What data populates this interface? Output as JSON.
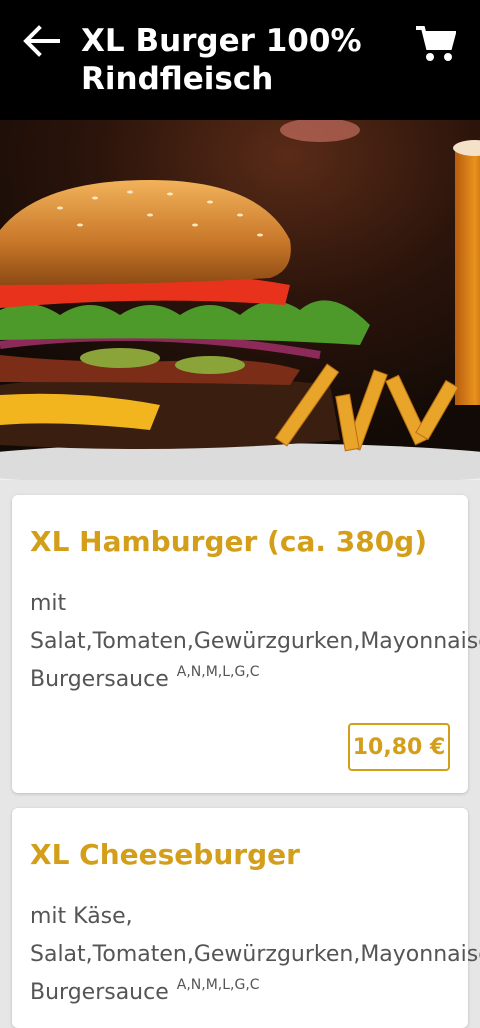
{
  "header": {
    "title": "XL Burger 100% Rindfleisch",
    "back_icon": "arrow-left-icon",
    "cart_icon": "shopping-cart-icon"
  },
  "products": [
    {
      "name": "XL Hamburger (ca. 380g)",
      "desc_line1": "mit",
      "desc_line2": "Salat,Tomaten,Gewürzgurken,Mayonnaise,",
      "desc_line3": "Burgersauce",
      "allergens": "A,N,M,L,G,C",
      "price": "10,80 €"
    },
    {
      "name": "XL Cheeseburger",
      "desc_line1": "mit Käse,",
      "desc_line2": "Salat,Tomaten,Gewürzgurken,Mayonnaise,",
      "desc_line3": "Burgersauce",
      "allergens": "A,N,M,L,G,C"
    }
  ],
  "colors": {
    "accent": "#d39e1a",
    "header_bg": "#000000",
    "page_bg": "#e6e6e6"
  }
}
